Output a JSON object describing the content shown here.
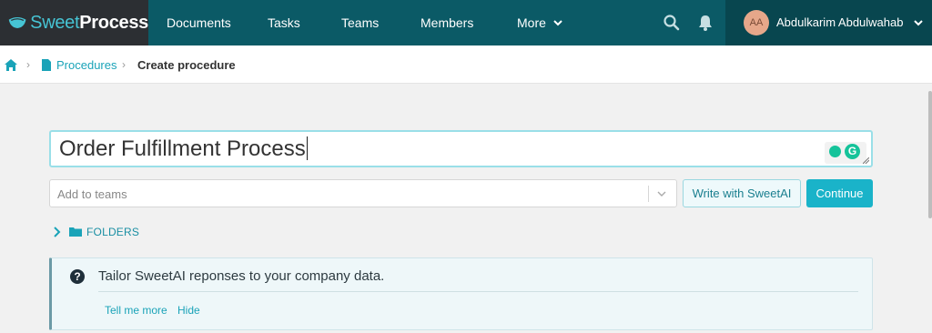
{
  "brand": {
    "name_light": "Sweet",
    "name_bold": "Process"
  },
  "nav": {
    "items": [
      "Documents",
      "Tasks",
      "Teams",
      "Members",
      "More"
    ],
    "icons": [
      "search-icon",
      "bell-icon"
    ]
  },
  "user": {
    "initials": "AA",
    "name": "Abdulkarim Abdulwahab"
  },
  "breadcrumb": {
    "parent": "Procedures",
    "current": "Create procedure"
  },
  "form": {
    "title_value": "Order Fulfillment Process",
    "teams_placeholder": "Add to teams",
    "write_ai_label": "Write with SweetAI",
    "continue_label": "Continue",
    "folders_label": "FOLDERS"
  },
  "info": {
    "message": "Tailor SweetAI reponses to your company data.",
    "link_more": "Tell me more",
    "link_hide": "Hide"
  },
  "colors": {
    "nav_bg": "#0b5a66",
    "brand_bg": "#2c2f33",
    "accent": "#1ab3c9",
    "link": "#1aa3b8"
  }
}
